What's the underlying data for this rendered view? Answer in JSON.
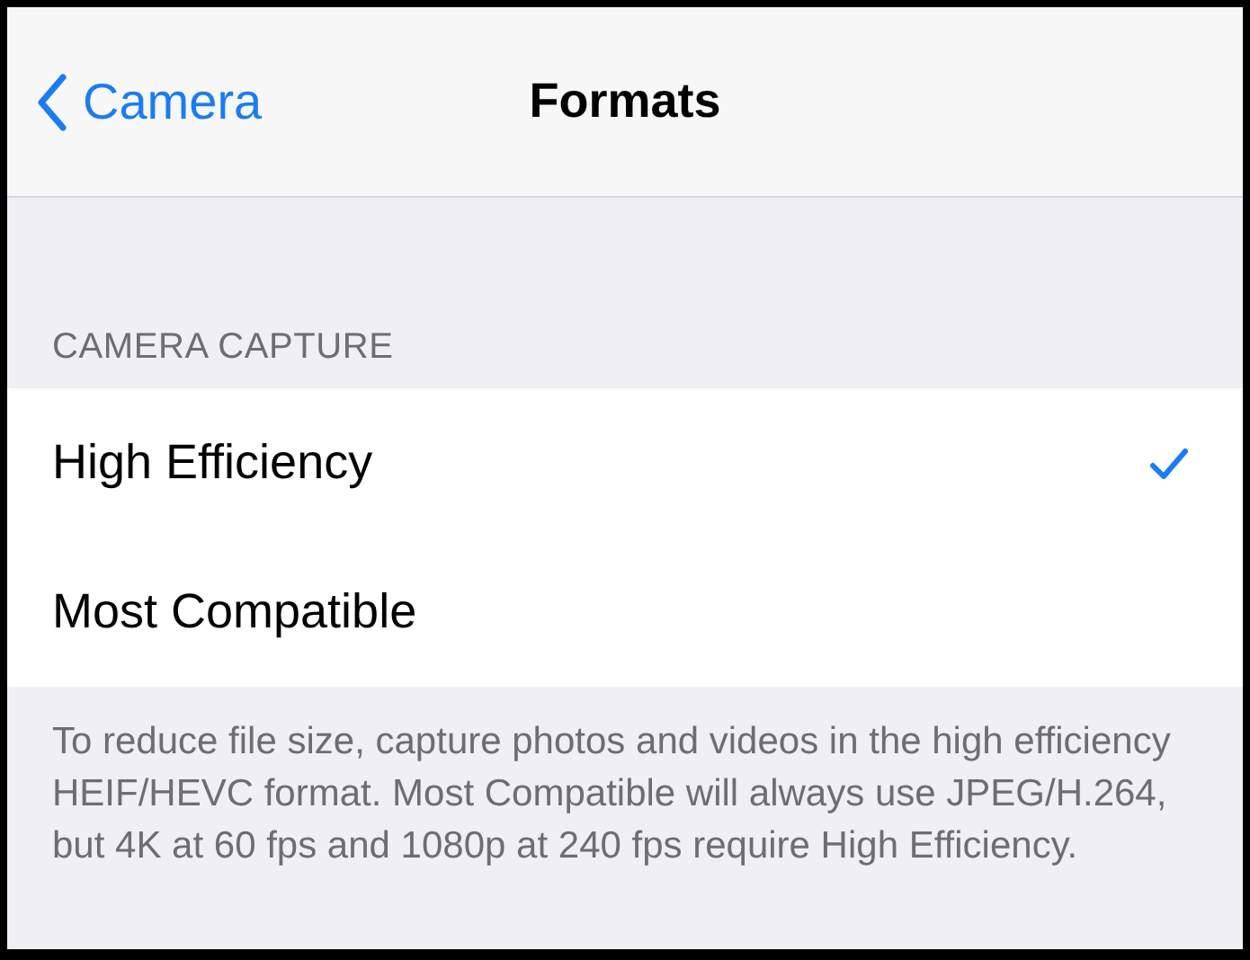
{
  "nav": {
    "back_label": "Camera",
    "title": "Formats"
  },
  "section": {
    "header": "CAMERA CAPTURE",
    "options": [
      {
        "label": "High Efficiency",
        "selected": true
      },
      {
        "label": "Most Compatible",
        "selected": false
      }
    ],
    "footer": "To reduce file size, capture photos and videos in the high efficiency HEIF/HEVC format. Most Compatible will always use JPEG/H.264, but 4K at 60 fps and 1080p at 240 fps require High Efficiency."
  }
}
